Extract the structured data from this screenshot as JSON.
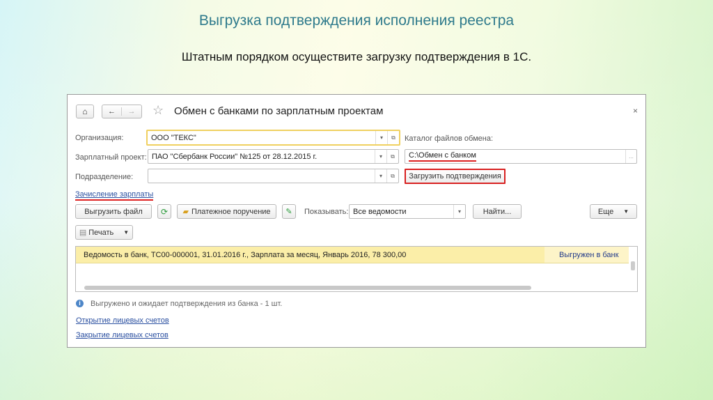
{
  "slide": {
    "title": "Выгрузка подтверждения исполнения реестра",
    "subtitle": "Штатным порядком осуществите загрузку подтверждения в 1С."
  },
  "window": {
    "title": "Обмен с банками по зарплатным проектам",
    "close": "×"
  },
  "form": {
    "org_label": "Организация:",
    "org_value": "ООО \"ТЕКС\"",
    "project_label": "Зарплатный проект:",
    "project_value": "ПАО \"Сбербанк России\" №125 от 28.12.2015 г.",
    "dept_label": "Подразделение:",
    "dept_value": "",
    "catalog_label": "Каталог файлов обмена:",
    "catalog_value": "C:\\Обмен с банком",
    "catalog_btn": "...",
    "load_btn": "Загрузить подтверждения",
    "salary_link": "Зачисление зарплаты"
  },
  "toolbar": {
    "export_file": "Выгрузить файл",
    "payment_order": "Платежное поручение",
    "show_label": "Показывать:",
    "show_value": "Все ведомости",
    "find": "Найти...",
    "more": "Еще",
    "print": "Печать"
  },
  "list": {
    "rows": [
      {
        "text": "Ведомость в банк, ТС00-000001, 31.01.2016 г., Зарплата за месяц, Январь 2016, 78 300,00",
        "status": "Выгружен в банк"
      }
    ]
  },
  "info": "Выгружено и ожидает подтверждения из банка - 1 шт.",
  "links": {
    "open": "Открытие лицевых счетов",
    "close": "Закрытие лицевых счетов"
  }
}
